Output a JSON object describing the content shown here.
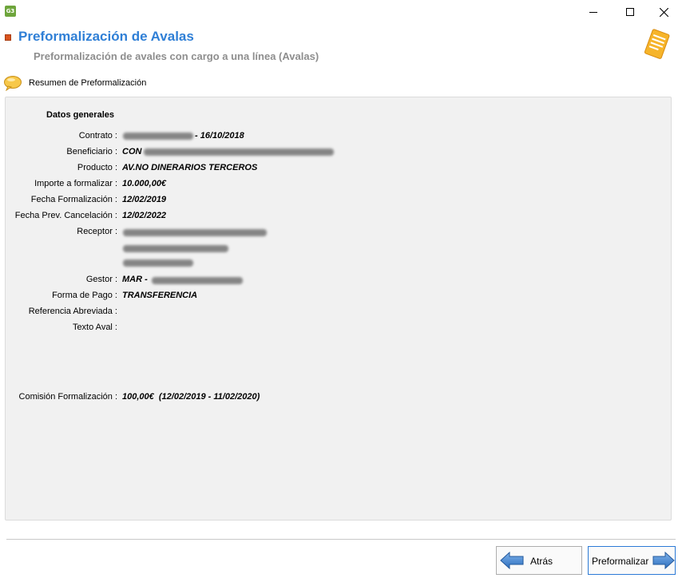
{
  "window": {
    "app_icon_text": "G3"
  },
  "header": {
    "title": "Preformalización de Avalas",
    "subtitle": "Preformalización de avales con cargo a una línea (Avalas)"
  },
  "section": {
    "label": "Resumen de Preformalización"
  },
  "panel": {
    "title": "Datos generales",
    "fields": {
      "contrato": {
        "label": "Contrato :",
        "value": "- 16/10/2018"
      },
      "beneficiario": {
        "label": "Beneficiario :",
        "value": "CON"
      },
      "producto": {
        "label": "Producto :",
        "value": "AV.NO DINERARIOS TERCEROS"
      },
      "importe": {
        "label": "Importe a formalizar :",
        "value": "10.000,00€"
      },
      "fecha_form": {
        "label": "Fecha Formalización :",
        "value": "12/02/2019"
      },
      "fecha_canc": {
        "label": "Fecha Prev. Cancelación :",
        "value": "12/02/2022"
      },
      "receptor": {
        "label": "Receptor :",
        "value": ""
      },
      "gestor": {
        "label": "Gestor :",
        "value": "MAR -"
      },
      "forma_pago": {
        "label": "Forma de Pago :",
        "value": "TRANSFERENCIA"
      },
      "referencia": {
        "label": "Referencia Abreviada :",
        "value": ""
      },
      "texto_aval": {
        "label": "Texto Aval :",
        "value": ""
      },
      "comision": {
        "label": "Comisión Formalización :",
        "value": "100,00€  (12/02/2019 - 11/02/2020)"
      }
    }
  },
  "footer": {
    "back_label": "Atrás",
    "next_label": "Preformalizar"
  },
  "colors": {
    "title_blue": "#2f7fd6",
    "subtitle_gray": "#8e8e8e",
    "panel_bg": "#f1f1f1",
    "accent_orange": "#f2a81d"
  }
}
